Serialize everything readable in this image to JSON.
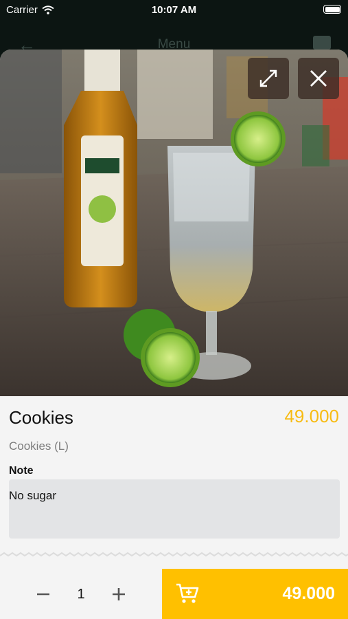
{
  "status_bar": {
    "carrier": "Carrier",
    "time": "10:07 AM"
  },
  "background_screen": {
    "title": "Menu"
  },
  "product": {
    "name": "Cookies",
    "price": "49.000",
    "variant": "Cookies (L)",
    "note_label": "Note",
    "note_value": "No sugar"
  },
  "order": {
    "quantity": "1",
    "total": "49.000"
  },
  "colors": {
    "accent": "#ffc000",
    "price": "#f7bb12",
    "note_bg": "#e3e4e6"
  },
  "icons": {
    "expand": "expand-icon",
    "close": "close-icon",
    "minus": "minus-icon",
    "plus": "plus-icon",
    "cart": "cart-add-icon",
    "wifi": "wifi-icon",
    "battery": "battery-icon",
    "back": "back-arrow-icon"
  }
}
